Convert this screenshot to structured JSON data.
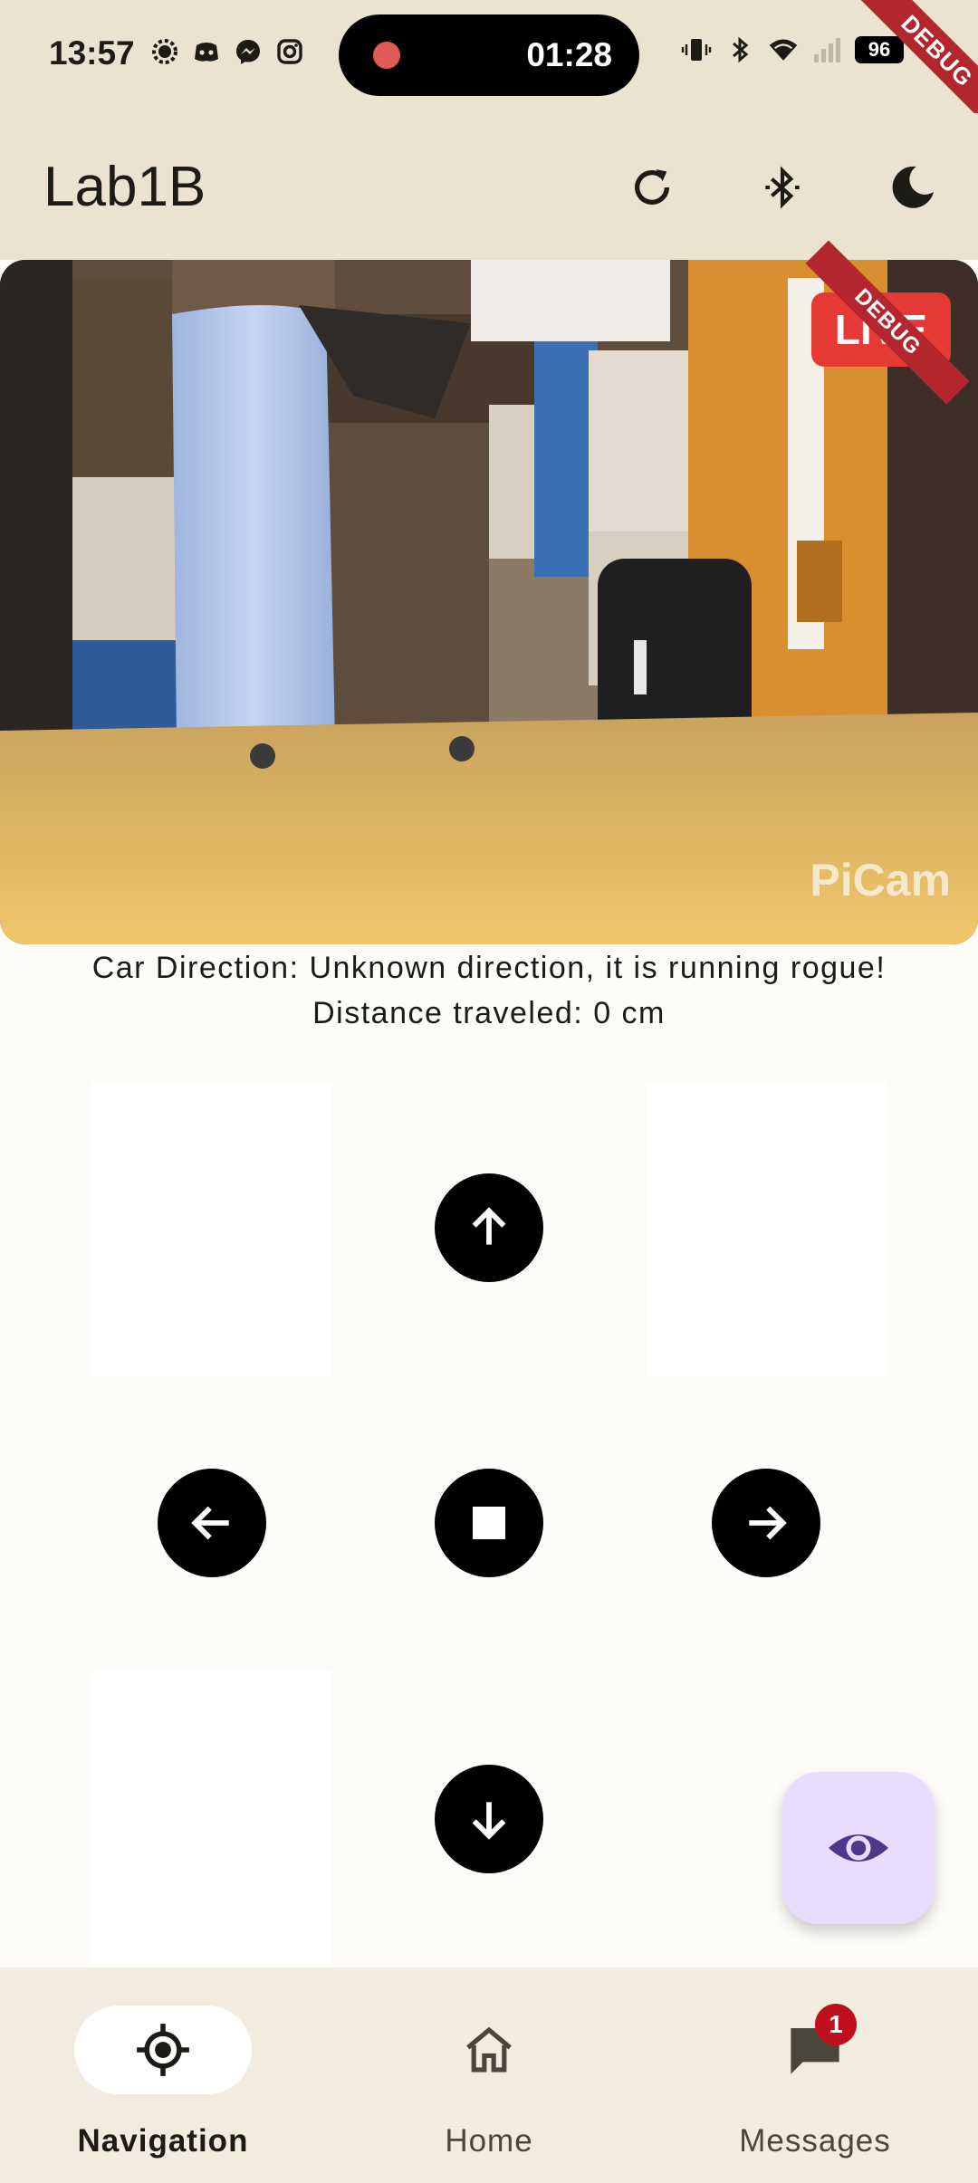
{
  "status_bar": {
    "time": "13:57",
    "recording_time": "01:28",
    "battery": "96",
    "left_icons": [
      "signal-messenger-icon",
      "discord-icon",
      "messenger-icon",
      "instagram-icon"
    ],
    "right_icons": [
      "vibrate-icon",
      "bluetooth-icon",
      "wifi-icon",
      "cell-signal-icon",
      "battery-icon"
    ]
  },
  "debug_banner": "DEBUG",
  "app_bar": {
    "title": "Lab1B",
    "actions": [
      "refresh-icon",
      "bluetooth-icon",
      "dark-mode-icon"
    ]
  },
  "camera": {
    "live_label": "LIVE",
    "source_label": "PiCam"
  },
  "info": {
    "direction": "Car Direction: Unknown direction, it is running rogue!",
    "distance": "Distance traveled: 0 cm"
  },
  "controls": [
    "forward",
    "left",
    "stop",
    "right",
    "backward"
  ],
  "fab": {
    "icon": "eye-icon"
  },
  "nav": {
    "items": [
      {
        "label": "Navigation",
        "icon": "gps-fixed-icon",
        "active": true
      },
      {
        "label": "Home",
        "icon": "home-icon",
        "active": false
      },
      {
        "label": "Messages",
        "icon": "chat-icon",
        "active": false,
        "badge": "1"
      }
    ]
  },
  "colors": {
    "surface": "#e9e3d0",
    "nav_bg": "#f2ecdf",
    "live_red": "#e53935",
    "fab_bg": "#e9ddff",
    "fab_icon": "#4f378b",
    "badge": "#c00f1c"
  }
}
